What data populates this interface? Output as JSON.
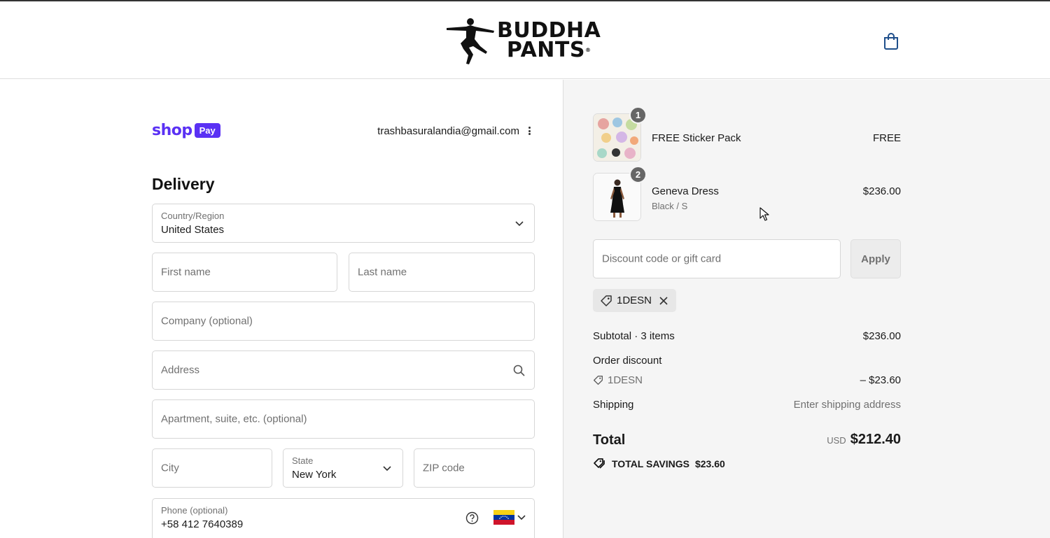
{
  "header": {
    "logo_line1": "BUDDHA",
    "logo_line2": "PANTS"
  },
  "account": {
    "shop_pay_word": "shop",
    "shop_pay_badge": "Pay",
    "email": "trashbasuralandia@gmail.com"
  },
  "delivery": {
    "title": "Delivery",
    "country_label": "Country/Region",
    "country_value": "United States",
    "first_name_placeholder": "First name",
    "last_name_placeholder": "Last name",
    "company_placeholder": "Company (optional)",
    "address_placeholder": "Address",
    "apartment_placeholder": "Apartment, suite, etc. (optional)",
    "city_placeholder": "City",
    "state_label": "State",
    "state_value": "New York",
    "zip_placeholder": "ZIP code",
    "phone_label": "Phone (optional)",
    "phone_value": "+58 412 7640389"
  },
  "summary": {
    "items": [
      {
        "qty": "1",
        "name": "FREE Sticker Pack",
        "variant": "",
        "price": "FREE"
      },
      {
        "qty": "2",
        "name": "Geneva Dress",
        "variant": "Black / S",
        "price": "$236.00"
      }
    ],
    "discount_placeholder": "Discount code or gift card",
    "apply_label": "Apply",
    "applied_code": "1DESN",
    "subtotal_label": "Subtotal · 3 items",
    "subtotal_value": "$236.00",
    "order_discount_label": "Order discount",
    "order_discount_code": "1DESN",
    "order_discount_value": "– $23.60",
    "shipping_label": "Shipping",
    "shipping_value": "Enter shipping address",
    "total_label": "Total",
    "total_currency": "USD",
    "total_value": "$212.40",
    "savings_label": "TOTAL SAVINGS",
    "savings_value": "$23.60"
  },
  "colors": {
    "shop_pay_purple": "#5a31f4",
    "panel_gray": "#f5f5f5"
  }
}
